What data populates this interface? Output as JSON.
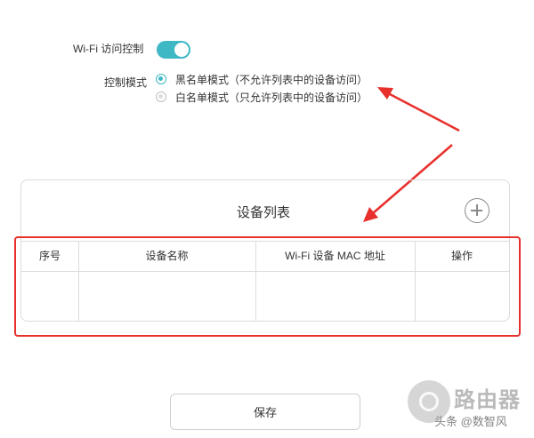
{
  "settings": {
    "wifi_access_label": "Wi-Fi 访问控制",
    "wifi_access_enabled": true,
    "control_mode_label": "控制模式",
    "modes": [
      {
        "label": "黑名单模式（不允许列表中的设备访问）",
        "selected": true
      },
      {
        "label": "白名单模式（只允许列表中的设备访问）",
        "selected": false
      }
    ]
  },
  "device_list": {
    "title": "设备列表",
    "columns": [
      "序号",
      "设备名称",
      "Wi-Fi 设备 MAC 地址",
      "操作"
    ],
    "rows": []
  },
  "save_label": "保存",
  "watermark": {
    "brand": "路由器",
    "caption": "头条 @数智风"
  },
  "colors": {
    "accent": "#3fb8c6",
    "annotation": "#e8302c"
  },
  "icons": {
    "add": "plus-circle-icon",
    "toggle": "toggle-switch"
  }
}
